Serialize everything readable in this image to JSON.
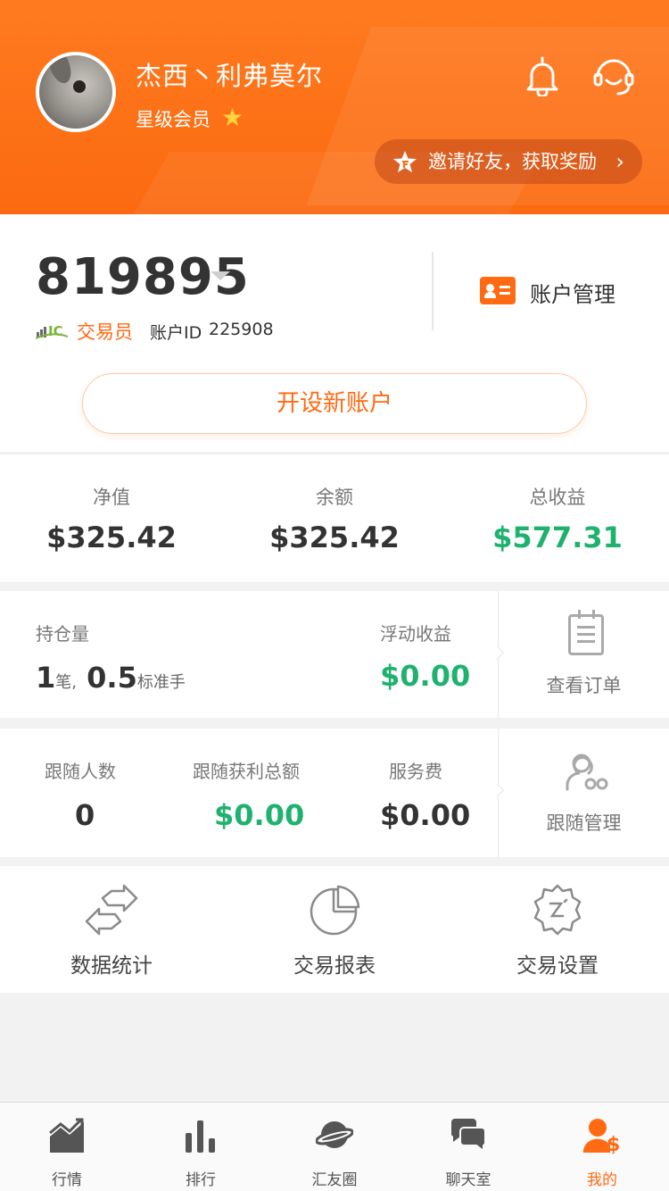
{
  "header": {
    "username": "杰西丶利弗莫尔",
    "member_level": "星级会员",
    "invite_text": "邀请好友，获取奖励",
    "invite_chevron": "›"
  },
  "account": {
    "number": "819895",
    "role": "交易员",
    "id_label": "账户ID",
    "id_value": "225908",
    "manage_label": "账户管理",
    "open_new_label": "开设新账户"
  },
  "balances": [
    {
      "label": "净值",
      "value": "$325.42"
    },
    {
      "label": "余额",
      "value": "$325.42"
    },
    {
      "label": "总收益",
      "value": "$577.31"
    }
  ],
  "positions": {
    "holding_label": "持仓量",
    "count": "1",
    "count_unit": "笔,",
    "lots": "0.5",
    "lots_unit": "标准手",
    "floating_label": "浮动收益",
    "floating_value": "$0.00",
    "view_orders_label": "查看订单"
  },
  "followers": {
    "count_label": "跟随人数",
    "count_value": "0",
    "profit_label": "跟随获利总额",
    "profit_value": "$0.00",
    "fee_label": "服务费",
    "fee_value": "$0.00",
    "manage_label": "跟随管理"
  },
  "tools": [
    {
      "label": "数据统计",
      "icon": "arrows-exchange-icon"
    },
    {
      "label": "交易报表",
      "icon": "pie-chart-icon"
    },
    {
      "label": "交易设置",
      "icon": "gear-settings-icon"
    }
  ],
  "tabbar": [
    {
      "label": "行情",
      "icon": "market-chart-icon"
    },
    {
      "label": "排行",
      "icon": "ranking-bars-icon"
    },
    {
      "label": "汇友圈",
      "icon": "planet-icon"
    },
    {
      "label": "聊天室",
      "icon": "chat-bubbles-icon"
    },
    {
      "label": "我的",
      "icon": "user-dollar-icon",
      "active": true
    }
  ],
  "colors": {
    "accent": "#ff6a13",
    "profit_green": "#1fb26f"
  }
}
